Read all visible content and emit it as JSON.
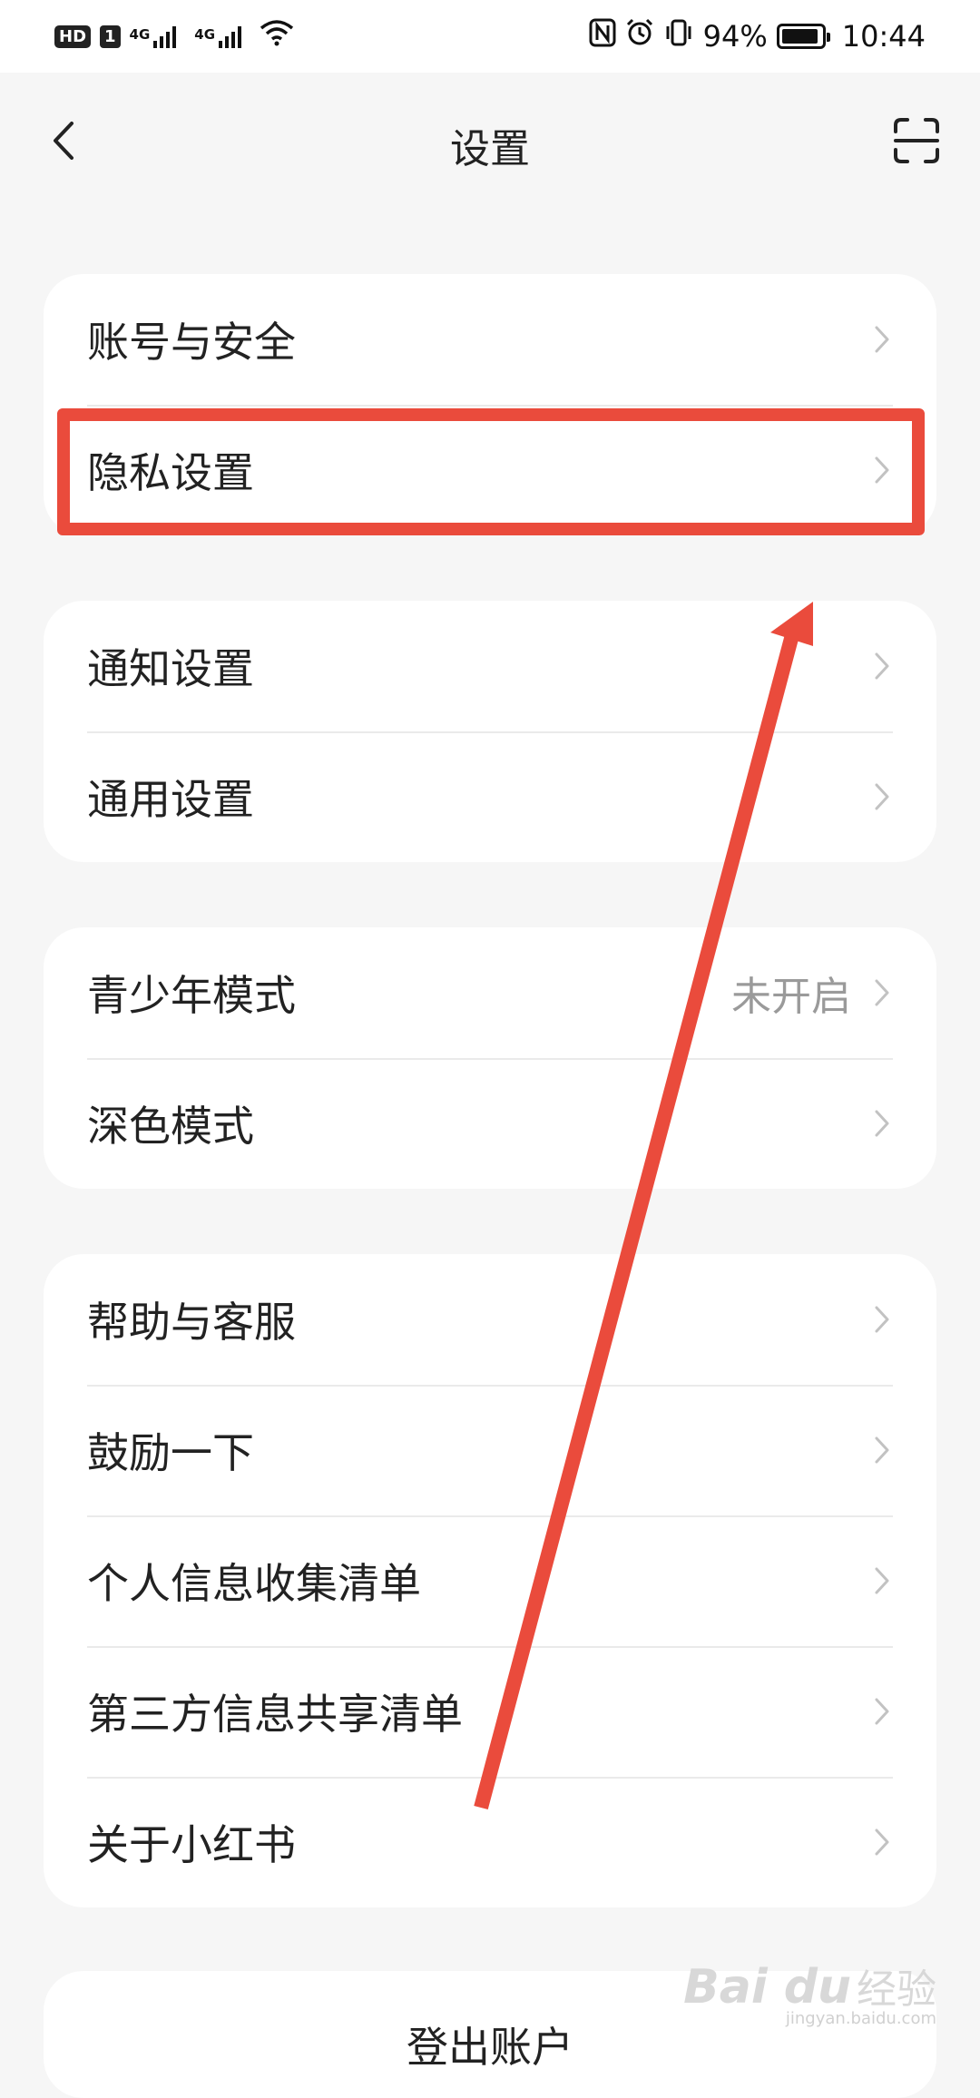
{
  "status_bar": {
    "hd": "HD",
    "sim": "1",
    "network1": "4G",
    "network2": "4G",
    "battery_percent": "94%",
    "battery_level": 0.94,
    "time": "10:44"
  },
  "header": {
    "title": "设置"
  },
  "groups": [
    {
      "items": [
        {
          "label": "账号与安全"
        },
        {
          "label": "隐私设置"
        }
      ]
    },
    {
      "items": [
        {
          "label": "通知设置"
        },
        {
          "label": "通用设置"
        }
      ]
    },
    {
      "items": [
        {
          "label": "青少年模式",
          "value": "未开启"
        },
        {
          "label": "深色模式"
        }
      ]
    },
    {
      "items": [
        {
          "label": "帮助与客服"
        },
        {
          "label": "鼓励一下"
        },
        {
          "label": "个人信息收集清单"
        },
        {
          "label": "第三方信息共享清单"
        },
        {
          "label": "关于小红书"
        }
      ]
    }
  ],
  "logout": {
    "label": "登出账户"
  },
  "watermark": {
    "brand": "Bai du",
    "jingyan": "经验",
    "url": "jingyan.baidu.com"
  },
  "annotation_color": "#ea4b3c"
}
